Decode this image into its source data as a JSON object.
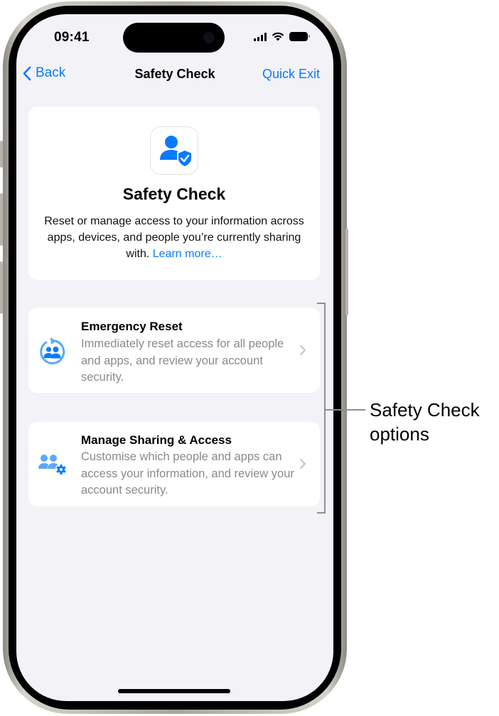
{
  "status_bar": {
    "time": "09:41",
    "icons": [
      "cellular-signal-icon",
      "wifi-icon",
      "battery-icon"
    ]
  },
  "nav": {
    "back_label": "Back",
    "title": "Safety Check",
    "quick_exit_label": "Quick Exit"
  },
  "header": {
    "icon": "person-shield-check-icon",
    "title": "Safety Check",
    "description": "Reset or manage access to your information across apps, devices, and people you’re currently sharing with.",
    "learn_more_label": "Learn more…"
  },
  "options": [
    {
      "icon": "people-reset-icon",
      "title": "Emergency Reset",
      "description": "Immediately reset access for all people and apps, and review your account security."
    },
    {
      "icon": "people-gear-icon",
      "title": "Manage Sharing & Access",
      "description": "Customise which people and apps can access your information, and review your account security."
    }
  ],
  "callout": {
    "label": "Safety Check options"
  },
  "colors": {
    "accent": "#0a7aff",
    "icon_light_blue": "#5aa8ff",
    "background": "#f2f2f7",
    "secondary_text": "#8a8a8e"
  }
}
